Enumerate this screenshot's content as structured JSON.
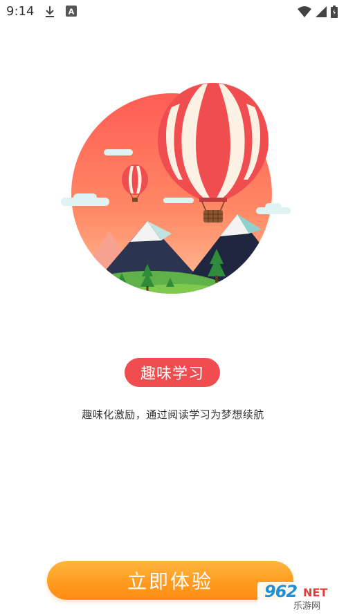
{
  "status_bar": {
    "time": "9:14",
    "icons_left": [
      "download-icon",
      "keyboard-a-icon"
    ],
    "icons_right": [
      "wifi-icon",
      "signal-icon",
      "battery-icon"
    ]
  },
  "illustration": {
    "subject": "hot-air-balloons-over-mountains",
    "colors": {
      "circle_top": "#ff6a5a",
      "circle_bottom": "#ffb08a",
      "balloon_red": "#ef4d4f",
      "balloon_cream": "#fdf1e3"
    }
  },
  "badge": {
    "label": "趣味学习",
    "color": "#ef4d4f"
  },
  "subtitle": "趣味化激励，通过阅读学习为梦想续航",
  "cta": {
    "label": "立即体验",
    "color": "#ff9a1e"
  },
  "watermark": {
    "num": "962",
    "net": "NET",
    "cn": "乐游网"
  }
}
